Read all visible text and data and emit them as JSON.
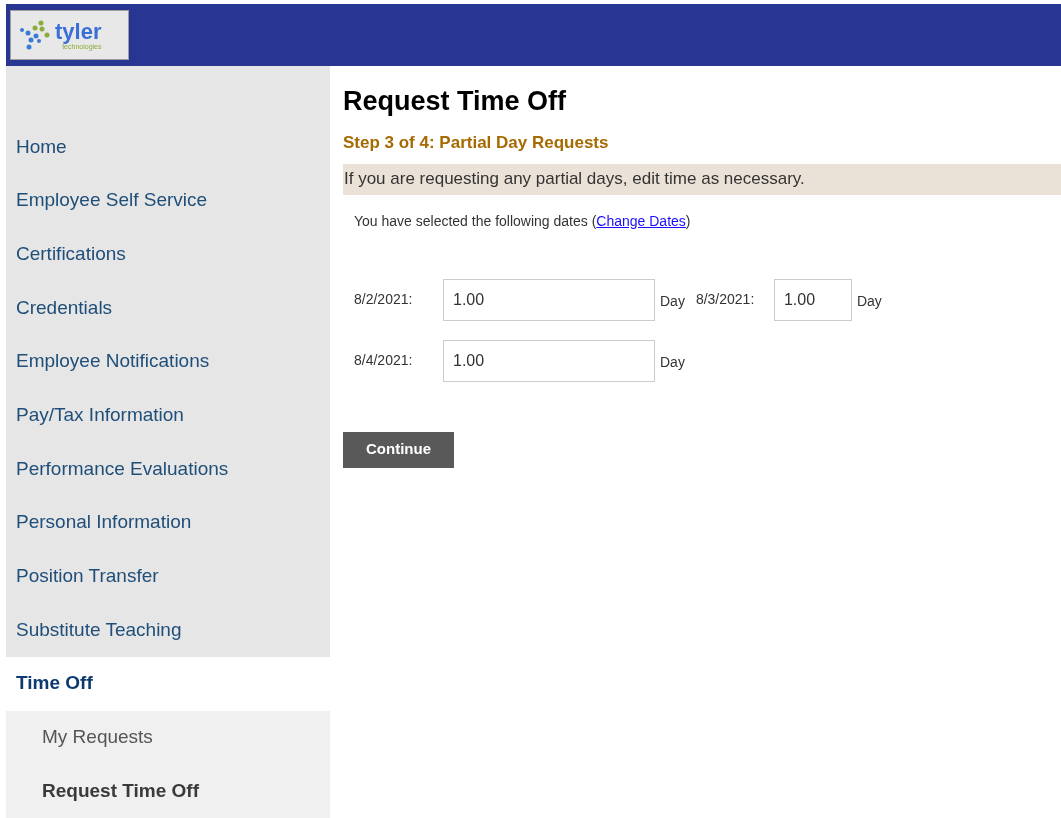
{
  "header": {
    "logo": {
      "name": "tyler",
      "tagline": "technologies"
    }
  },
  "sidebar": {
    "items": [
      {
        "label": "Home",
        "selected": false
      },
      {
        "label": "Employee Self Service",
        "selected": false
      },
      {
        "label": "Certifications",
        "selected": false
      },
      {
        "label": "Credentials",
        "selected": false
      },
      {
        "label": "Employee Notifications",
        "selected": false
      },
      {
        "label": "Pay/Tax Information",
        "selected": false
      },
      {
        "label": "Performance Evaluations",
        "selected": false
      },
      {
        "label": "Personal Information",
        "selected": false
      },
      {
        "label": "Position Transfer",
        "selected": false
      },
      {
        "label": "Substitute Teaching",
        "selected": false
      },
      {
        "label": "Time Off",
        "selected": true,
        "children": [
          {
            "label": "My Requests",
            "selected": false
          },
          {
            "label": "Request Time Off",
            "selected": true
          }
        ]
      }
    ]
  },
  "main": {
    "title": "Request Time Off",
    "step": "Step 3 of 4: Partial Day Requests",
    "instructions": "If you are requesting any partial days, edit time as necessary.",
    "selected_text": "You have selected the following dates (",
    "change_link": "Change Dates",
    "selected_text_end": ")",
    "date_rows": [
      [
        {
          "date": "8/2/2021:",
          "value": "1.00",
          "unit": "Day"
        },
        {
          "date": "8/3/2021:",
          "value": "1.00",
          "unit": "Day"
        }
      ],
      [
        {
          "date": "8/4/2021:",
          "value": "1.00",
          "unit": "Day"
        }
      ]
    ],
    "continue_button": "Continue"
  }
}
